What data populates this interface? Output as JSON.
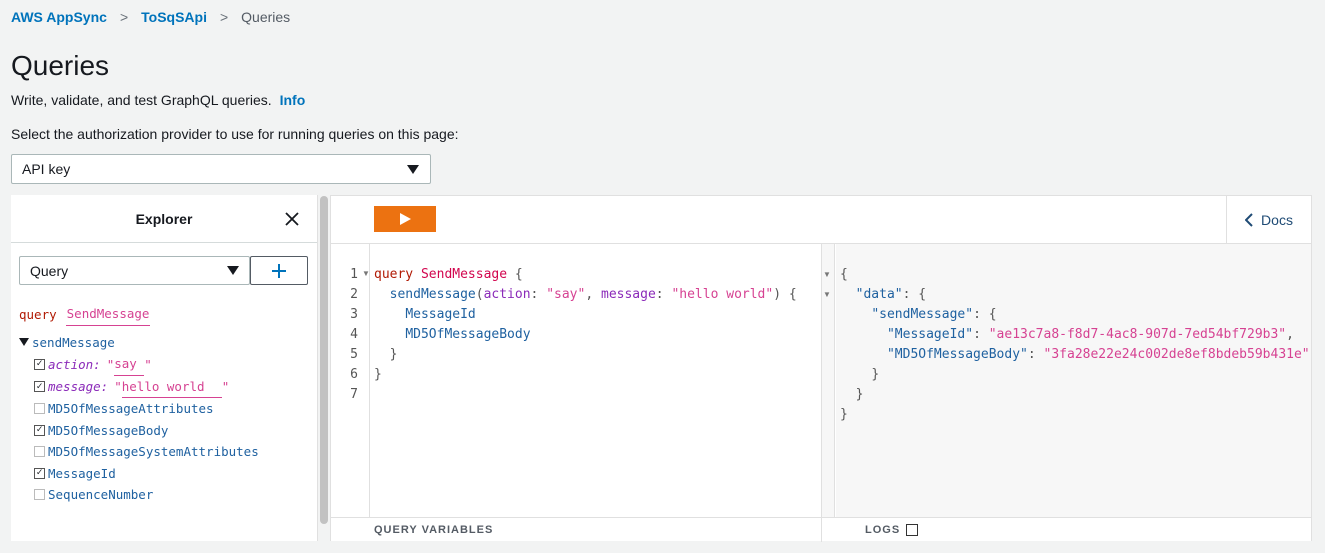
{
  "breadcrumb": {
    "service": "AWS AppSync",
    "api": "ToSqSApi",
    "current": "Queries",
    "separator": ">"
  },
  "page": {
    "title": "Queries",
    "description": "Write, validate, and test GraphQL queries.",
    "info_link": "Info",
    "auth_label": "Select the authorization provider to use for running queries on this page:",
    "auth_value": "API key"
  },
  "explorer": {
    "title": "Explorer",
    "operation_type": "Query",
    "op_keyword": "query",
    "op_name": "SendMessage",
    "root_field": "sendMessage",
    "args": [
      {
        "name": "action:",
        "value": "say",
        "checked": true
      },
      {
        "name": "message:",
        "value": "hello world",
        "checked": true
      }
    ],
    "fields": [
      {
        "name": "MD5OfMessageAttributes",
        "checked": false
      },
      {
        "name": "MD5OfMessageBody",
        "checked": true
      },
      {
        "name": "MD5OfMessageSystemAttributes",
        "checked": false
      },
      {
        "name": "MessageId",
        "checked": true
      },
      {
        "name": "SequenceNumber",
        "checked": false
      }
    ],
    "quote": "\""
  },
  "editor": {
    "docs_label": "Docs",
    "line_numbers": [
      "1",
      "2",
      "3",
      "4",
      "5",
      "6",
      "7"
    ],
    "code": {
      "l1_kw": "query",
      "l1_name": "SendMessage",
      "l1_brace": "{",
      "l2_field": "sendMessage",
      "l2_open": "(",
      "l2_arg1": "action",
      "l2_val1": "\"say\"",
      "l2_arg2": "message",
      "l2_val2": "\"hello world\"",
      "l2_close": ") {",
      "l3": "MessageId",
      "l4": "MD5OfMessageBody",
      "l5": "}",
      "l6": "}"
    },
    "result": {
      "open": "{",
      "data_key": "\"data\"",
      "send_key": "\"sendMessage\"",
      "msgid_key": "\"MessageId\"",
      "msgid_val": "\"ae13c7a8-f8d7-4ac8-907d-7ed54bf729b3\"",
      "md5_key": "\"MD5OfMessageBody\"",
      "md5_val": "\"3fa28e22e24c002de8ef8bdeb59b431e\""
    },
    "query_variables_label": "QUERY VARIABLES",
    "logs_label": "LOGS"
  }
}
